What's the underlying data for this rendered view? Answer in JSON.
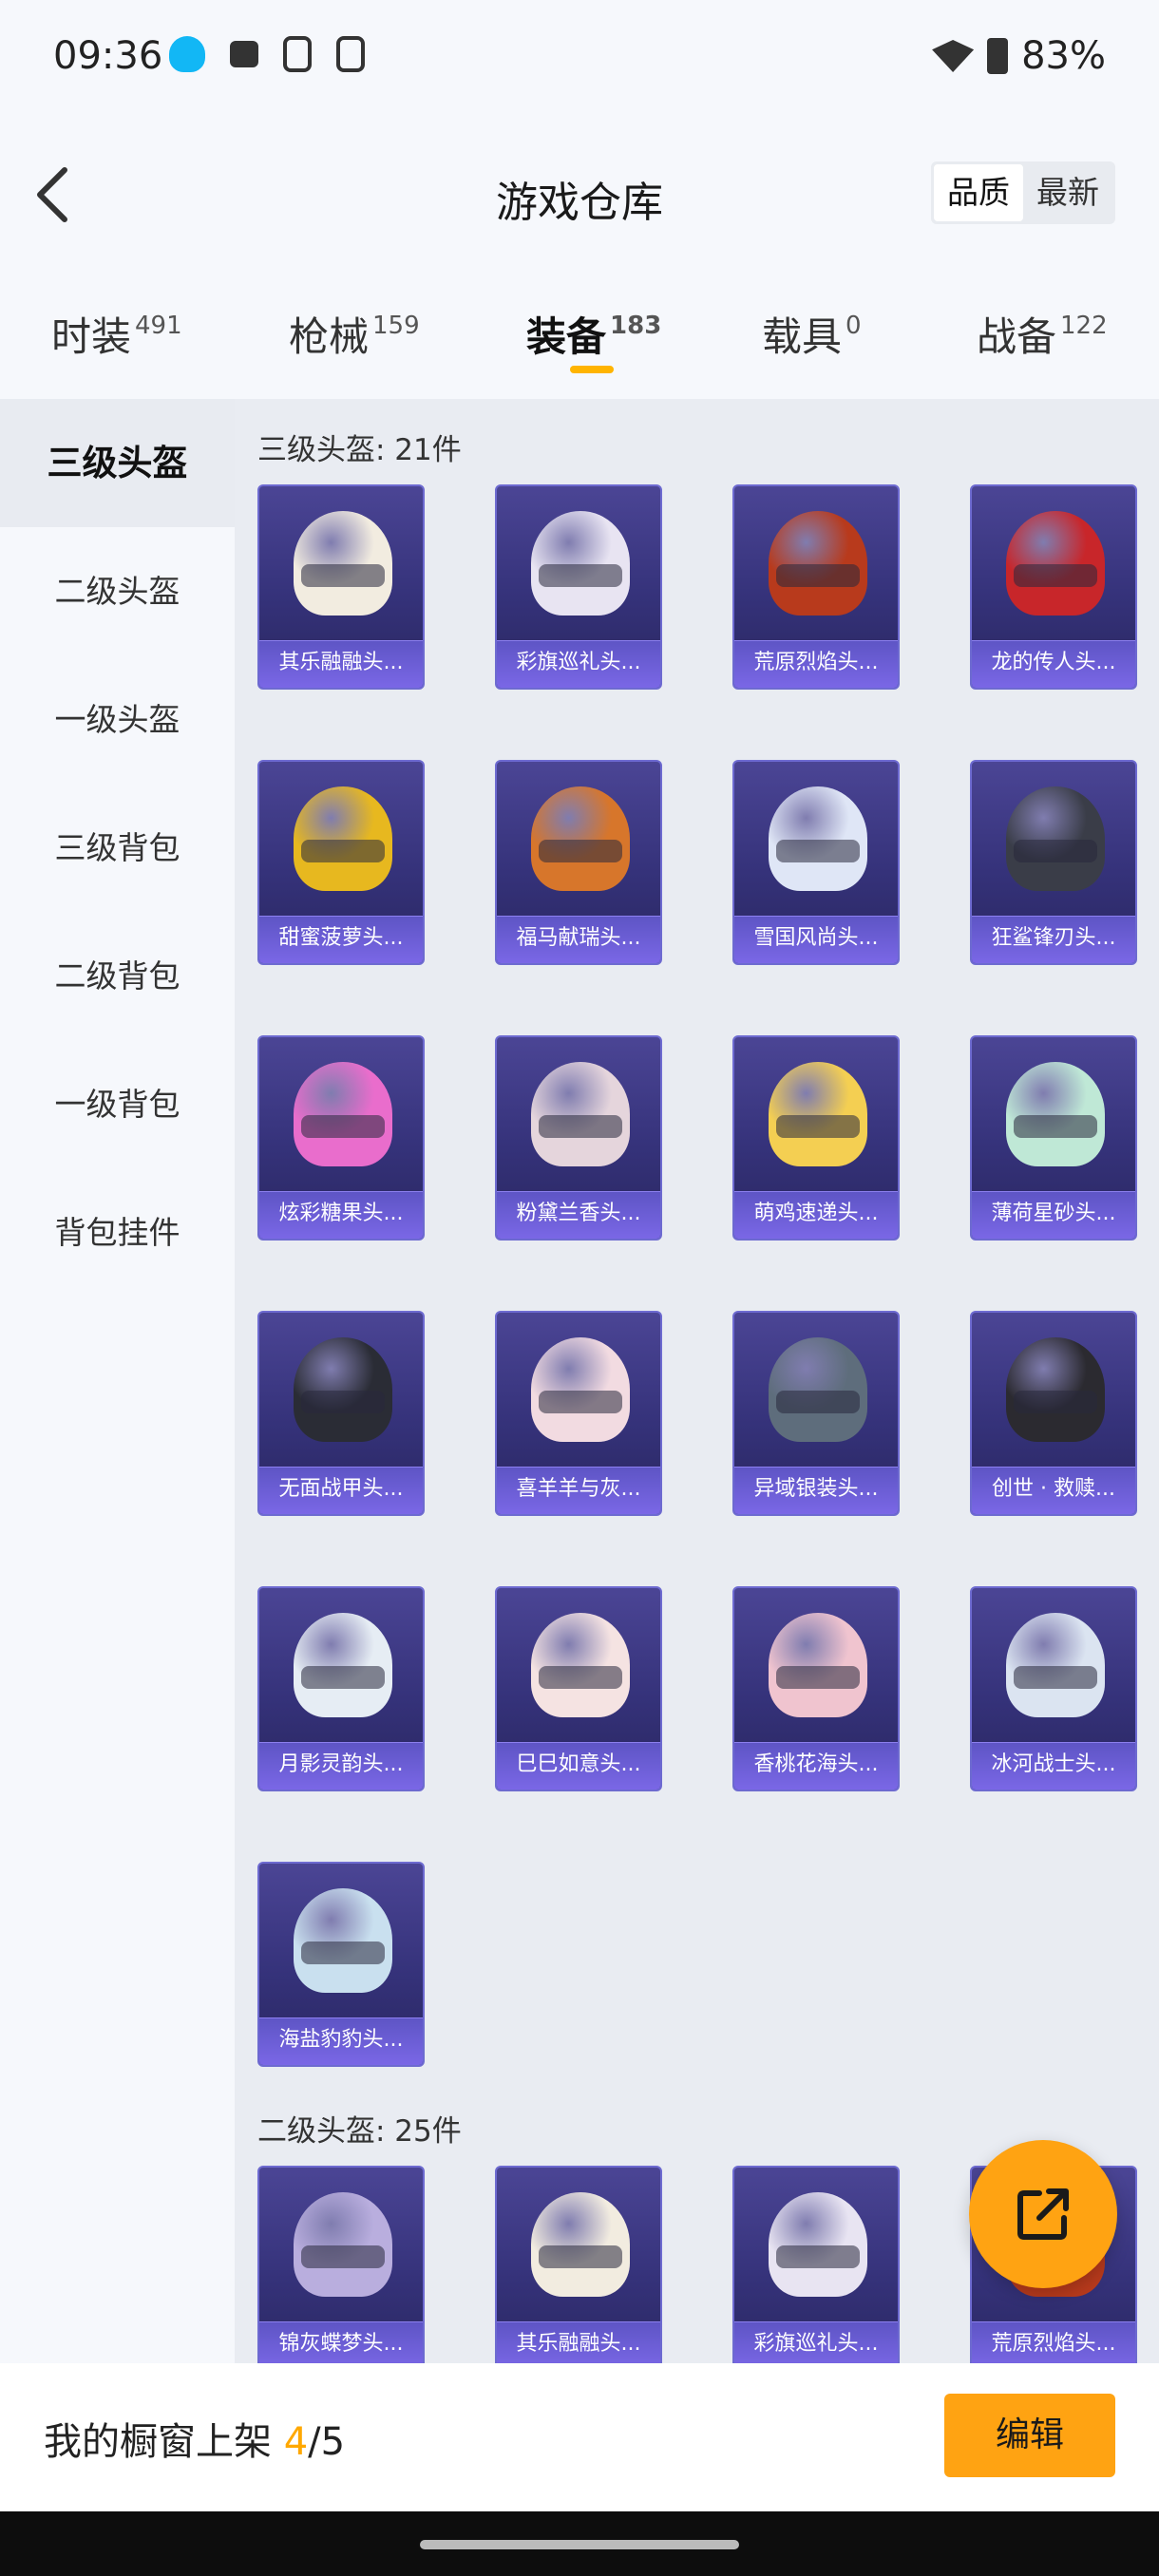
{
  "status_bar": {
    "time": "09:36",
    "battery": "83%"
  },
  "header": {
    "title": "游戏仓库",
    "sort_quality": "品质",
    "sort_latest": "最新"
  },
  "tabs": [
    {
      "label": "时装",
      "count": "491"
    },
    {
      "label": "枪械",
      "count": "159"
    },
    {
      "label": "装备",
      "count": "183"
    },
    {
      "label": "载具",
      "count": "0"
    },
    {
      "label": "战备",
      "count": "122"
    }
  ],
  "sidebar": {
    "items": [
      "三级头盔",
      "二级头盔",
      "一级头盔",
      "三级背包",
      "二级背包",
      "一级背包",
      "背包挂件"
    ]
  },
  "sections": [
    {
      "title": "三级头盔: 21件",
      "items": [
        {
          "label": "其乐融融头...",
          "color": "#f2ece0"
        },
        {
          "label": "彩旗巡礼头...",
          "color": "#e8e4f2"
        },
        {
          "label": "荒原烈焰头...",
          "color": "#b83a1c"
        },
        {
          "label": "龙的传人头...",
          "color": "#c8262a"
        },
        {
          "label": "甜蜜菠萝头...",
          "color": "#e7b81f"
        },
        {
          "label": "福马献瑞头...",
          "color": "#d7762b"
        },
        {
          "label": "雪国风尚头...",
          "color": "#dfe6f6"
        },
        {
          "label": "狂鲨锋刃头...",
          "color": "#3a3d48"
        },
        {
          "label": "炫彩糖果头...",
          "color": "#e96dcc"
        },
        {
          "label": "粉黛兰香头...",
          "color": "#e5d5dc"
        },
        {
          "label": "萌鸡速递头...",
          "color": "#f4cf52"
        },
        {
          "label": "薄荷星砂头...",
          "color": "#bfe8d6"
        },
        {
          "label": "无面战甲头...",
          "color": "#2a2c35"
        },
        {
          "label": "喜羊羊与灰...",
          "color": "#f2dbe1"
        },
        {
          "label": "异域银装头...",
          "color": "#5e6d7c"
        },
        {
          "label": "创世 · 救赎...",
          "color": "#2b2a30"
        },
        {
          "label": "月影灵韵头...",
          "color": "#e6edf4"
        },
        {
          "label": "巳巳如意头...",
          "color": "#f5e3e2"
        },
        {
          "label": "香桃花海头...",
          "color": "#f0c4cf"
        },
        {
          "label": "冰河战士头...",
          "color": "#dbe4f1"
        },
        {
          "label": "海盐豹豹头...",
          "color": "#c9e0ef"
        }
      ]
    },
    {
      "title": "二级头盔: 25件",
      "items": [
        {
          "label": "锦灰蝶梦头...",
          "color": "#b9aede"
        },
        {
          "label": "其乐融融头...",
          "color": "#f2ece0"
        },
        {
          "label": "彩旗巡礼头...",
          "color": "#e8e4f2"
        },
        {
          "label": "荒原烈焰头...",
          "color": "#b83a1c"
        }
      ]
    }
  ],
  "bottom_bar": {
    "prefix": "我的橱窗上架 ",
    "current": "4",
    "suffix": "/5",
    "edit_label": "编辑"
  },
  "colors": {
    "accent": "#ffa312",
    "card_bg": "#35327a",
    "sidebar_bg": "#f6f8fc",
    "content_bg": "#e9ecf2"
  }
}
